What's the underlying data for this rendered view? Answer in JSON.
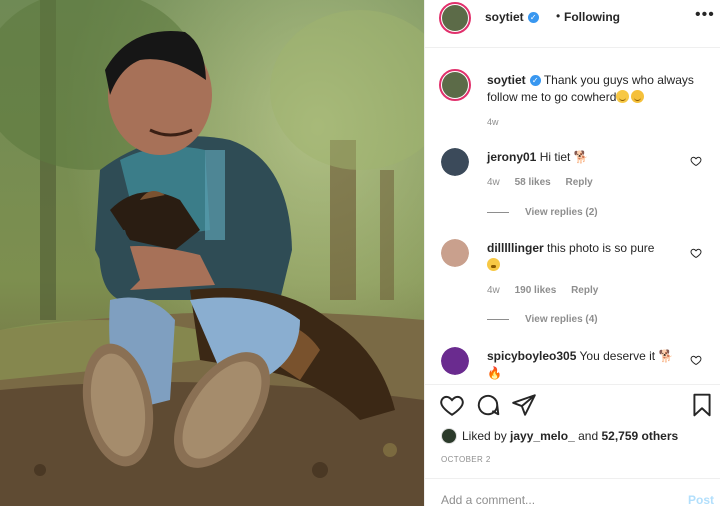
{
  "header": {
    "username": "soytiet",
    "separator": "•",
    "follow_status": "Following",
    "more_icon": "more-horizontal-icon"
  },
  "caption": {
    "username": "soytiet",
    "text": "Thank you guys who always follow me to go cowherd",
    "emojis": [
      "grinning-face-icon",
      "rolling-laughing-face-icon"
    ],
    "time": "4w"
  },
  "comments": [
    {
      "username": "jerony01",
      "text": "Hi tiet",
      "emoji": "dog-icon",
      "time": "4w",
      "likes": "58 likes",
      "reply": "Reply",
      "view_replies": "View replies (2)",
      "avatar_color": "#3b4a5a"
    },
    {
      "username": "dilllllinger",
      "text": "this photo is so pure",
      "emoji": "smiling-face-icon",
      "time": "4w",
      "likes": "190 likes",
      "reply": "Reply",
      "view_replies": "View replies (4)",
      "avatar_color": "#c9a08d"
    },
    {
      "username": "spicyboyleo305",
      "text": "You deserve it",
      "emoji": "dog-icon",
      "emoji2": "fire-icon",
      "avatar_color": "#6a2b8f"
    }
  ],
  "actions": {
    "like_icon": "heart-icon",
    "comment_icon": "comment-icon",
    "share_icon": "paper-plane-icon",
    "save_icon": "bookmark-icon"
  },
  "likes": {
    "prefix": "Liked by",
    "user": "jayy_melo_",
    "connector": "and",
    "count": "52,759 others"
  },
  "date": "OCTOBER 2",
  "composer": {
    "placeholder": "Add a comment...",
    "post_label": "Post"
  },
  "colors": {
    "verified": "#3897f0",
    "story_ring": "#e1306c",
    "post_disabled": "#b2dffc"
  }
}
